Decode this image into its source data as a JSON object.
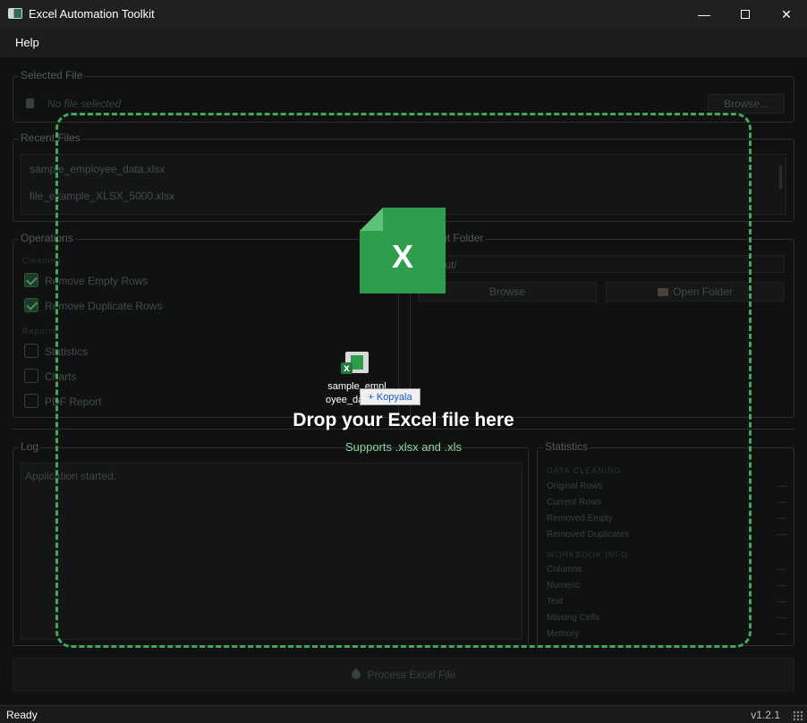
{
  "window": {
    "title": "Excel Automation Toolkit"
  },
  "menu": {
    "help": "Help"
  },
  "selected_file": {
    "title": "Selected File",
    "placeholder": "No file selected",
    "browse": "Browse..."
  },
  "recent_files": {
    "title": "Recent Files",
    "items": [
      "sample_employee_data.xlsx",
      "file_example_XLSX_5000.xlsx"
    ]
  },
  "operations": {
    "title": "Operations",
    "cleaning_label": "Cleaning",
    "reports_label": "Reports",
    "options": [
      {
        "label": "Remove Empty Rows",
        "checked": true
      },
      {
        "label": "Remove Duplicate Rows",
        "checked": true
      },
      {
        "label": "Statistics",
        "checked": false
      },
      {
        "label": "Charts",
        "checked": false
      },
      {
        "label": "PDF Report",
        "checked": false
      }
    ]
  },
  "output_folder": {
    "title": "Output Folder",
    "path": "output/",
    "browse": "Browse",
    "open": "Open Folder"
  },
  "log": {
    "title": "Log",
    "text": "Application started."
  },
  "statistics": {
    "title": "Statistics",
    "cleaning_heading": "DATA CLEANING",
    "workbook_heading": "WORKBOOK INFO",
    "rows": [
      {
        "label": "Original Rows",
        "value": "—"
      },
      {
        "label": "Current Rows",
        "value": "—"
      },
      {
        "label": "Removed Empty",
        "value": "—"
      },
      {
        "label": "Removed Duplicates",
        "value": "—"
      },
      {
        "label": "Columns",
        "value": "—"
      },
      {
        "label": "Numeric",
        "value": "—"
      },
      {
        "label": "Text",
        "value": "—"
      },
      {
        "label": "Missing Cells",
        "value": "—"
      },
      {
        "label": "Memory",
        "value": "—"
      }
    ]
  },
  "process_button": "Process Excel File",
  "drop_overlay": {
    "title": "Drop your Excel file here",
    "subtitle": "Supports .xlsx and .xls",
    "excel_letter": "X",
    "accent": "#3fa85e"
  },
  "drag": {
    "file_name_line1": "sample_empl",
    "file_name_line2": "oyee_da",
    "copy_label": "+ Kopyala"
  },
  "status": {
    "text": "Ready",
    "version": "v1.2.1"
  }
}
